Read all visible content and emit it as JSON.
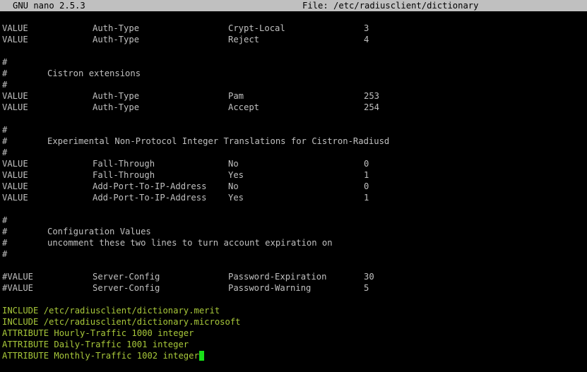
{
  "titlebar": {
    "app": "GNU nano 2.5.3",
    "file": "File: /etc/radiusclient/dictionary"
  },
  "lines": [
    {
      "type": "row",
      "cols": [
        "VALUE",
        "Auth-Type",
        "Crypt-Local",
        "3"
      ]
    },
    {
      "type": "row",
      "cols": [
        "VALUE",
        "Auth-Type",
        "Reject",
        "4"
      ]
    },
    {
      "type": "blank"
    },
    {
      "type": "hash"
    },
    {
      "type": "comment",
      "text": "Cistron extensions"
    },
    {
      "type": "hash"
    },
    {
      "type": "row",
      "cols": [
        "VALUE",
        "Auth-Type",
        "Pam",
        "253"
      ]
    },
    {
      "type": "row",
      "cols": [
        "VALUE",
        "Auth-Type",
        "Accept",
        "254"
      ]
    },
    {
      "type": "blank"
    },
    {
      "type": "hash"
    },
    {
      "type": "comment",
      "text": "Experimental Non-Protocol Integer Translations for Cistron-Radiusd"
    },
    {
      "type": "hash"
    },
    {
      "type": "row",
      "cols": [
        "VALUE",
        "Fall-Through",
        "No",
        "0"
      ]
    },
    {
      "type": "row",
      "cols": [
        "VALUE",
        "Fall-Through",
        "Yes",
        "1"
      ]
    },
    {
      "type": "row",
      "cols": [
        "VALUE",
        "Add-Port-To-IP-Address",
        "No",
        "0"
      ]
    },
    {
      "type": "row",
      "cols": [
        "VALUE",
        "Add-Port-To-IP-Address",
        "Yes",
        "1"
      ]
    },
    {
      "type": "blank"
    },
    {
      "type": "hash"
    },
    {
      "type": "comment",
      "text": "Configuration Values"
    },
    {
      "type": "comment",
      "text": "uncomment these two lines to turn account expiration on"
    },
    {
      "type": "hash"
    },
    {
      "type": "blank"
    },
    {
      "type": "row",
      "cols": [
        "#VALUE",
        "Server-Config",
        "Password-Expiration",
        "30"
      ]
    },
    {
      "type": "row",
      "cols": [
        "#VALUE",
        "Server-Config",
        "Password-Warning",
        "5"
      ]
    },
    {
      "type": "blank"
    },
    {
      "type": "green",
      "text": "INCLUDE /etc/radiusclient/dictionary.merit"
    },
    {
      "type": "green",
      "text": "INCLUDE /etc/radiusclient/dictionary.microsoft"
    },
    {
      "type": "green",
      "text": "ATTRIBUTE Hourly-Traffic 1000 integer"
    },
    {
      "type": "green",
      "text": "ATTRIBUTE Daily-Traffic 1001 integer"
    },
    {
      "type": "green",
      "text": "ATTRIBUTE Monthly-Traffic 1002 integer",
      "cursor": true
    }
  ],
  "colors": {
    "background": "#000000",
    "text": "#c0c0c0",
    "titlebar_bg": "#c0c0c0",
    "include_text": "#a8c83a",
    "cursor": "#18e018"
  },
  "icons": [
    "text-cursor"
  ]
}
